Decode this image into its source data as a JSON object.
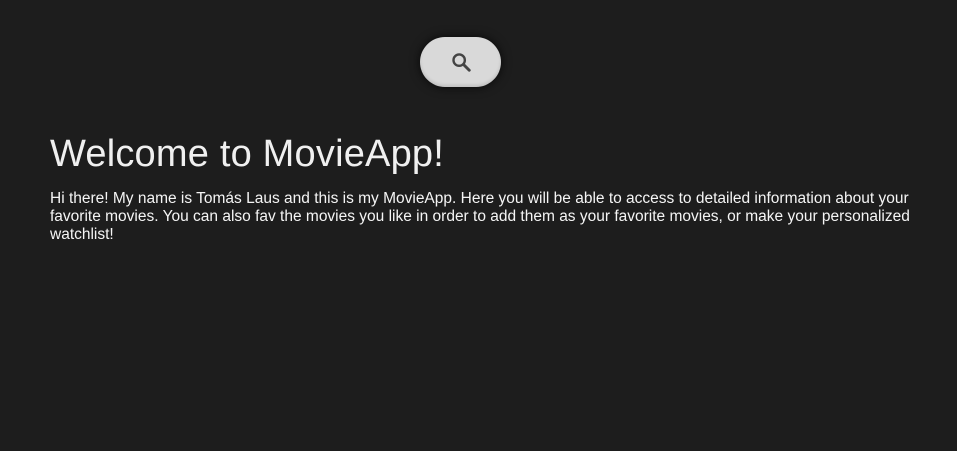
{
  "search": {
    "icon": "magnifying-glass-icon"
  },
  "main": {
    "title": "Welcome to MovieApp!",
    "intro": "Hi there! My name is Tomás Laus and this is my MovieApp. Here you will be able to access to detailed information about your favorite movies. You can also fav the movies you like in order to add them as your favorite movies, or make your personalized watchlist!"
  },
  "colors": {
    "background": "#1d1d1d",
    "button": "#d9d9d9",
    "text": "#f2f2f2"
  }
}
